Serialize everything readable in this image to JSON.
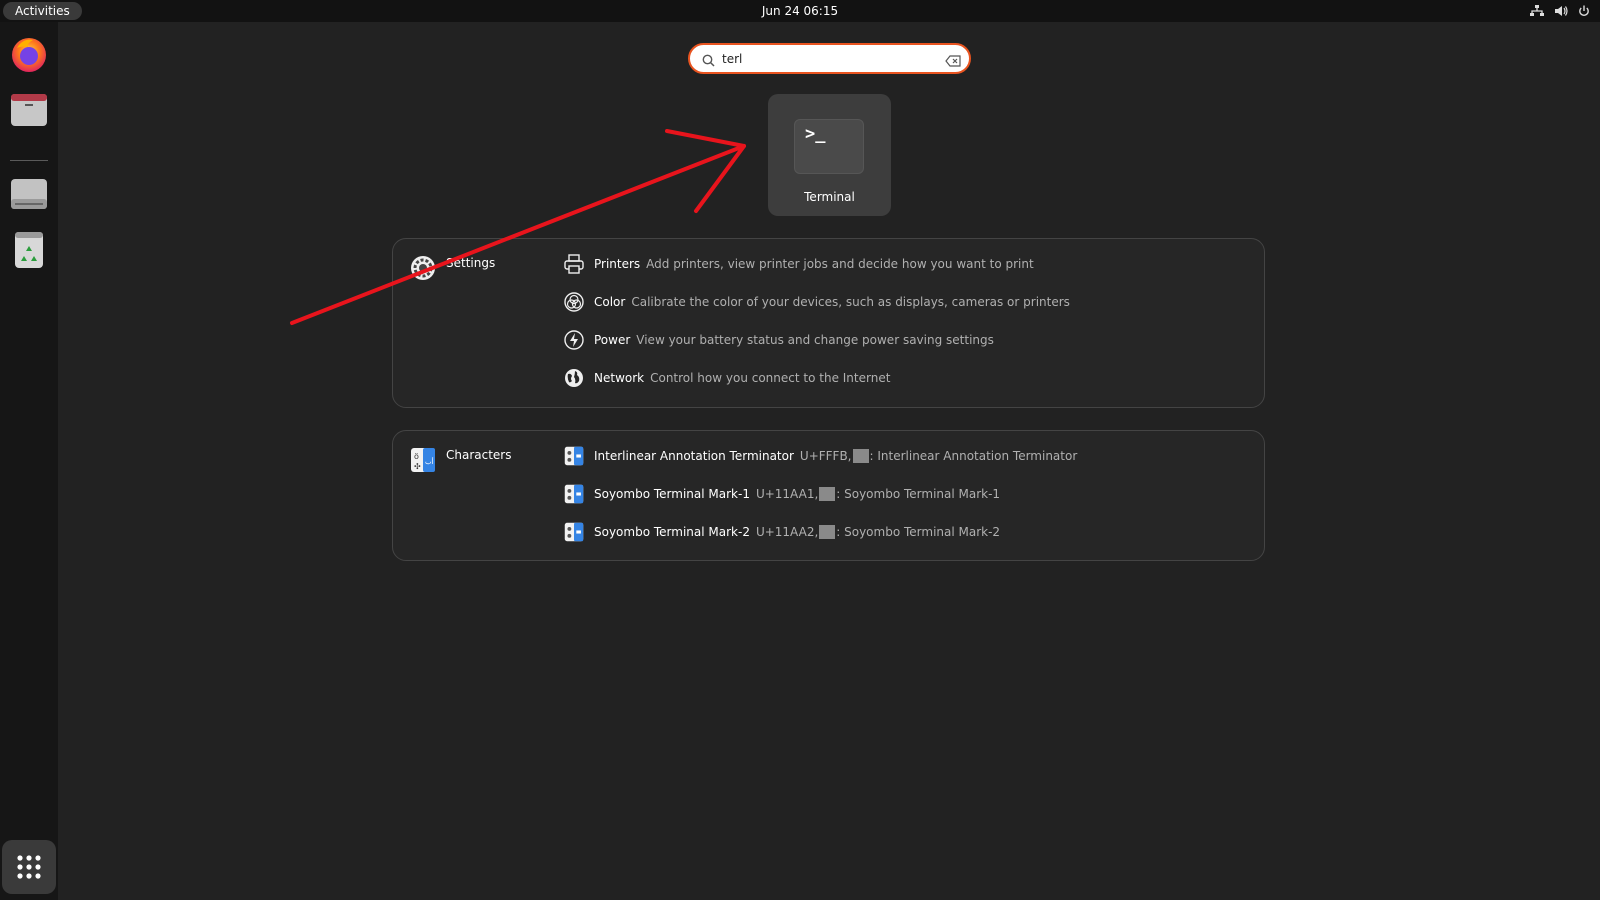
{
  "topbar": {
    "activities_label": "Activities",
    "clock": "Jun 24  06:15"
  },
  "dock": {
    "items": [
      "firefox-icon",
      "files-icon",
      "drive-icon",
      "trash-icon"
    ],
    "apps_grid": "show-apps-icon"
  },
  "search": {
    "value": "terl"
  },
  "app_result": {
    "label": "Terminal",
    "icon_text": ">_"
  },
  "settings_panel": {
    "provider": "Settings",
    "rows": [
      {
        "title": "Printers",
        "desc": "Add printers, view printer jobs and decide how you want to print"
      },
      {
        "title": "Color",
        "desc": "Calibrate the color of your devices, such as displays, cameras or printers"
      },
      {
        "title": "Power",
        "desc": "View your battery status and change power saving settings"
      },
      {
        "title": "Network",
        "desc": "Control how you connect to the Internet"
      }
    ]
  },
  "characters_panel": {
    "provider": "Characters",
    "rows": [
      {
        "title": "Interlinear Annotation Terminator",
        "code": "U+FFFB,",
        "desc": ": Interlinear Annotation Terminator"
      },
      {
        "title": "Soyombo Terminal Mark-1",
        "code": "U+11AA1,",
        "desc": ": Soyombo Terminal Mark-1"
      },
      {
        "title": "Soyombo Terminal Mark-2",
        "code": "U+11AA2,",
        "desc": ": Soyombo Terminal Mark-2"
      }
    ]
  },
  "colors": {
    "accent": "#e95420",
    "annotation_arrow": "#e8141c"
  }
}
